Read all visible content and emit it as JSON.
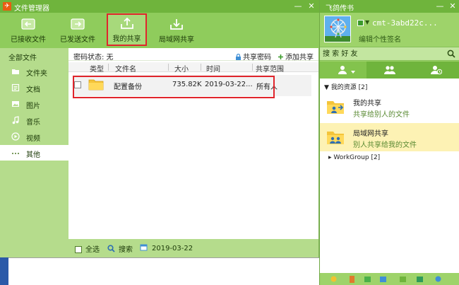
{
  "colors": {
    "window_green": "#b5dc8c",
    "toolbar_green": "#8fcc5c",
    "titlebar_green": "#6fb43c",
    "highlight_red": "#e0252c",
    "selected_resource": "#fdf2b4"
  },
  "file_manager": {
    "title": "文件管理器",
    "controls": {
      "minimize": "—",
      "maximize": "□",
      "close": "✕"
    },
    "toolbar": [
      {
        "label": "已接收文件",
        "icon": "inbox-arrow-icon"
      },
      {
        "label": "已发送文件",
        "icon": "outbox-arrow-icon"
      },
      {
        "label": "我的共享",
        "icon": "share-upload-icon",
        "active": true
      },
      {
        "label": "局域网共享",
        "icon": "lan-download-icon"
      }
    ],
    "sidebar": {
      "header": "全部文件",
      "items": [
        {
          "label": "文件夹",
          "icon": "folder-icon"
        },
        {
          "label": "文档",
          "icon": "document-icon"
        },
        {
          "label": "图片",
          "icon": "image-icon"
        },
        {
          "label": "音乐",
          "icon": "music-icon"
        },
        {
          "label": "视频",
          "icon": "video-icon"
        },
        {
          "label": "其他",
          "icon": "more-dots-icon",
          "selected": true
        }
      ]
    },
    "password_bar": {
      "status": "密码状态: 无",
      "share_password": "共享密码",
      "add_share": "添加共享"
    },
    "columns": [
      "类型",
      "文件名",
      "大小",
      "时间",
      "共享范围"
    ],
    "rows": [
      {
        "name": "配置备份",
        "size": "735.82K",
        "time": "2019-03-22...",
        "scope": "所有人"
      }
    ],
    "footer": {
      "select_all": "全选",
      "search": "搜索",
      "date": "2019-03-22"
    }
  },
  "messenger": {
    "title": "飞鸽传书",
    "controls": {
      "minimize": "—",
      "close": "✕"
    },
    "username": "cmt-3abd22c...",
    "signature": "编辑个性签名",
    "search_placeholder": "搜 索 好 友",
    "groups": {
      "my_resources": "我的资源 [2]",
      "workgroup": "WorkGroup [2]"
    },
    "resources": [
      {
        "name": "我的共享",
        "desc": "共享给别人的文件"
      },
      {
        "name": "局域网共享",
        "desc": "别人共享给我的文件",
        "selected": true
      }
    ]
  }
}
